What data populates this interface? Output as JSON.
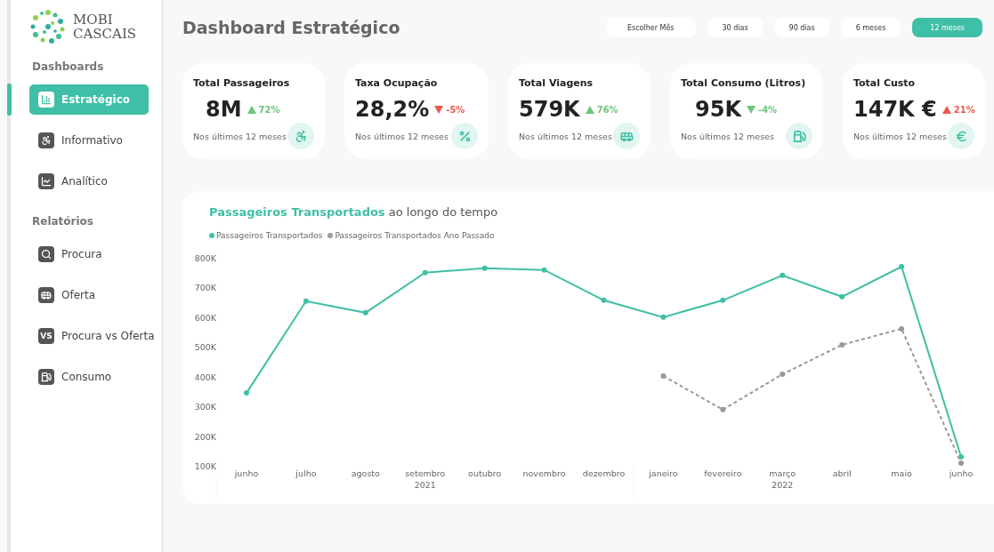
{
  "logo": {
    "line_1": "MOBI",
    "line_2": "CASCAIS"
  },
  "sidebar": {
    "sections": [
      {
        "title": "Dashboards",
        "items": [
          {
            "label": "Estratégico",
            "selected": true
          },
          {
            "label": "Informativo",
            "selected": false
          },
          {
            "label": "Analítico",
            "selected": false
          }
        ]
      },
      {
        "title": "Relatórios",
        "items": [
          {
            "label": "Procura",
            "selected": false
          },
          {
            "label": "Oferta",
            "selected": false
          },
          {
            "label": "Procura vs Oferta",
            "selected": false,
            "badge": "VS"
          },
          {
            "label": "Consumo",
            "selected": false
          }
        ]
      }
    ]
  },
  "header": {
    "title": "Dashboard Estratégico"
  },
  "periods": [
    {
      "label": "Escolher Mês",
      "selected": false
    },
    {
      "label": "30 dias",
      "selected": false
    },
    {
      "label": "90 dias",
      "selected": false
    },
    {
      "label": "6 meses",
      "selected": false
    },
    {
      "label": "12 meses",
      "selected": true
    }
  ],
  "kpis": [
    {
      "title": "Total Passageiros",
      "value": "8M",
      "delta": "72%",
      "kind": "up",
      "good": true,
      "caption": "Nos últimos 12 meses"
    },
    {
      "title": "Taxa Ocupação",
      "value": "28,2%",
      "delta": "-5%",
      "kind": "down",
      "good": false,
      "caption": "Nos últimos 12 meses"
    },
    {
      "title": "Total Viagens",
      "value": "579K",
      "delta": "76%",
      "kind": "up",
      "good": true,
      "caption": "Nos últimos 12 meses"
    },
    {
      "title": "Total Consumo (Litros)",
      "value": "95K",
      "delta": "-4%",
      "kind": "down",
      "good": true,
      "caption": "Nos últimos 12 meses"
    },
    {
      "title": "Total Custo",
      "value": "147K €",
      "delta": "21%",
      "kind": "up",
      "good": false,
      "caption": "Nos últimos 12 meses"
    }
  ],
  "chart": {
    "title": "**Passageiros Transportados** ao longo do tempo",
    "year_labels": [
      {
        "label": "2021"
      },
      {
        "label": "2022"
      }
    ],
    "chart_data": {
      "type": "line",
      "categories": [
        "junho",
        "julho",
        "agosto",
        "setembro",
        "outubro",
        "novembro",
        "dezembro",
        "janeiro",
        "fevereiro",
        "março",
        "abril",
        "maio",
        "junho"
      ],
      "series": [
        {
          "name": "Passageiros Transportados",
          "color": "#3fbfa5",
          "marker": "circle",
          "line_style": "solid",
          "values": [
            345000,
            654000,
            615000,
            750000,
            765000,
            759000,
            657000,
            600000,
            657000,
            741000,
            669000,
            770000,
            130000
          ]
        },
        {
          "name": "Passageiros Transportados Ano Passado",
          "color": "#999999",
          "marker": "circle",
          "line_style": "dashed",
          "values": [
            null,
            null,
            null,
            null,
            null,
            null,
            null,
            402000,
            289000,
            408000,
            507000,
            561000,
            109000
          ]
        }
      ],
      "ylim": [
        100000,
        800000
      ],
      "yticks": [
        {
          "value": 100000,
          "label": "100K"
        },
        {
          "value": 200000,
          "label": "200K"
        },
        {
          "value": 300000,
          "label": "300K"
        },
        {
          "value": 400000,
          "label": "400K"
        },
        {
          "value": 500000,
          "label": "500K"
        },
        {
          "value": 600000,
          "label": "600K"
        },
        {
          "value": 700000,
          "label": "700K"
        },
        {
          "value": 800000,
          "label": "800K"
        }
      ]
    }
  }
}
